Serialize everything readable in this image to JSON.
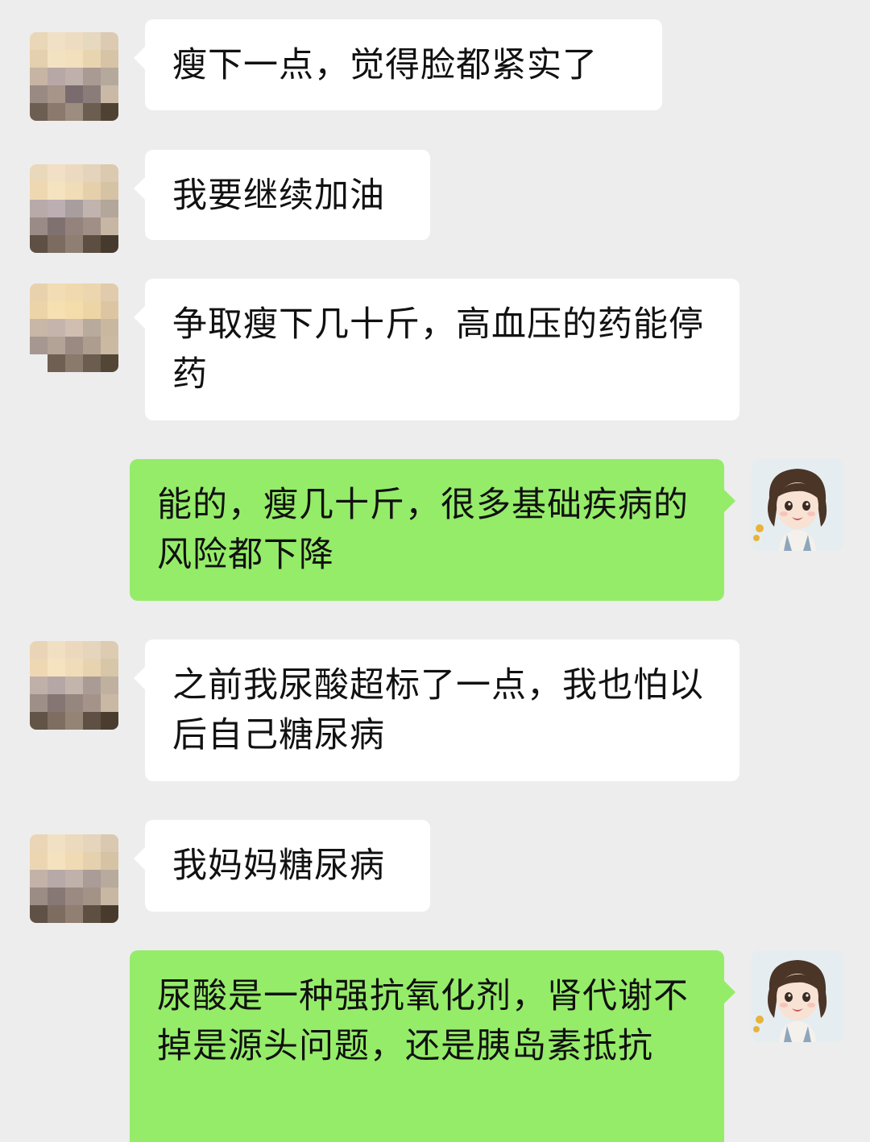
{
  "messages": [
    {
      "side": "in",
      "text": "瘦下一点，觉得脸都紧实了"
    },
    {
      "side": "in",
      "text": "我要继续加油"
    },
    {
      "side": "in",
      "text": "争取瘦下几十斤，高血压的药能停药"
    },
    {
      "side": "out",
      "text": "能的，瘦几十斤，很多基础疾病的风险都下降"
    },
    {
      "side": "in",
      "text": "之前我尿酸超标了一点，我也怕以后自己糖尿病"
    },
    {
      "side": "in",
      "text": "我妈妈糖尿病"
    },
    {
      "side": "out",
      "text": "尿酸是一种强抗氧化剂，肾代谢不掉是源头问题，还是胰岛素抵抗"
    }
  ],
  "colors": {
    "background": "#ededed",
    "incoming_bubble": "#ffffff",
    "outgoing_bubble": "#95ec69"
  },
  "icons": {
    "contact_avatar": "pixelated-avatar-icon",
    "my_avatar": "cartoon-girl-avatar-icon"
  }
}
